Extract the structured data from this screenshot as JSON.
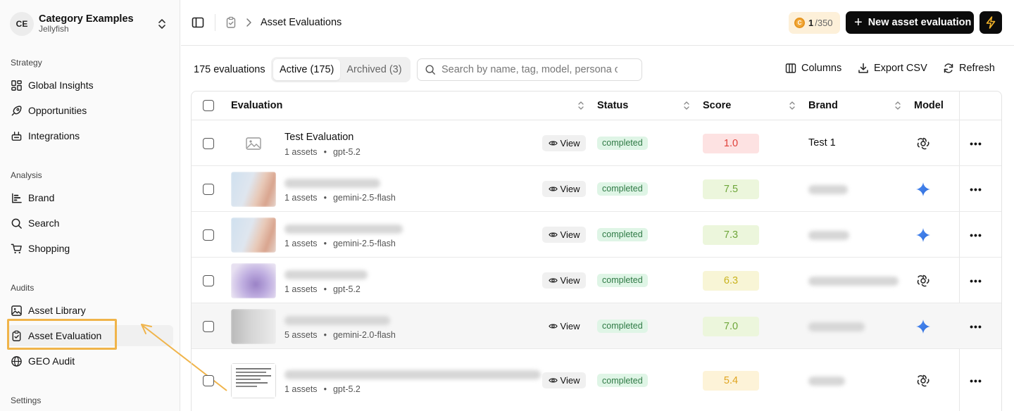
{
  "workspace": {
    "initials": "CE",
    "name": "Category Examples",
    "subtitle": "Jellyfish"
  },
  "sidebar": {
    "sections": [
      {
        "label": "Strategy",
        "items": [
          "Global Insights",
          "Opportunities",
          "Integrations"
        ]
      },
      {
        "label": "Analysis",
        "items": [
          "Brand",
          "Search",
          "Shopping"
        ]
      },
      {
        "label": "Audits",
        "items": [
          "Asset Library",
          "Asset Evaluation",
          "GEO Audit"
        ]
      },
      {
        "label": "Settings",
        "items": []
      }
    ],
    "active": "Asset Evaluation"
  },
  "header": {
    "breadcrumb": "Asset Evaluations",
    "credits_used": "1",
    "credits_total": "/350",
    "new_button": "New asset evaluation"
  },
  "toolbar": {
    "count": "175 evaluations",
    "tab_active": "Active (175)",
    "tab_archived": "Archived (3)",
    "search_placeholder": "Search by name, tag, model, persona or",
    "columns": "Columns",
    "export": "Export CSV",
    "refresh": "Refresh"
  },
  "table": {
    "headers": {
      "evaluation": "Evaluation",
      "status": "Status",
      "score": "Score",
      "brand": "Brand",
      "model": "Model"
    },
    "view_label": "View",
    "rows": [
      {
        "name": "Test Evaluation",
        "assets": "1 assets",
        "model_name": "gpt-5.2",
        "status": "completed",
        "score": "1.0",
        "score_bg": "#fde2e2",
        "score_fg": "#e0413a",
        "brand": "Test 1",
        "model_icon": "openai-icon",
        "thumb": "placeholder"
      },
      {
        "name": "",
        "assets": "1 assets",
        "model_name": "gemini-2.5-flash",
        "status": "completed",
        "score": "7.5",
        "score_bg": "#ecf6dc",
        "score_fg": "#6ea63a",
        "brand": "",
        "model_icon": "gemini-icon",
        "thumb": "blur-portrait"
      },
      {
        "name": "",
        "assets": "1 assets",
        "model_name": "gemini-2.5-flash",
        "status": "completed",
        "score": "7.3",
        "score_bg": "#ecf6dc",
        "score_fg": "#6ea63a",
        "brand": "",
        "model_icon": "gemini-icon",
        "thumb": "blur-portrait"
      },
      {
        "name": "",
        "assets": "1 assets",
        "model_name": "gpt-5.2",
        "status": "completed",
        "score": "6.3",
        "score_bg": "#f8f5d6",
        "score_fg": "#c9b31e",
        "brand": "",
        "model_icon": "openai-icon",
        "thumb": "blur-purple"
      },
      {
        "name": "",
        "assets": "5 assets",
        "model_name": "gemini-2.0-flash",
        "status": "completed",
        "score": "7.0",
        "score_bg": "#ecf6dc",
        "score_fg": "#6ea63a",
        "brand": "",
        "model_icon": "gemini-icon",
        "thumb": "blur-gray"
      },
      {
        "name": "",
        "assets": "1 assets",
        "model_name": "gpt-5.2",
        "status": "completed",
        "score": "5.4",
        "score_bg": "#fdf3d8",
        "score_fg": "#e0a521",
        "brand": "",
        "model_icon": "openai-icon",
        "thumb": "doc"
      }
    ]
  }
}
